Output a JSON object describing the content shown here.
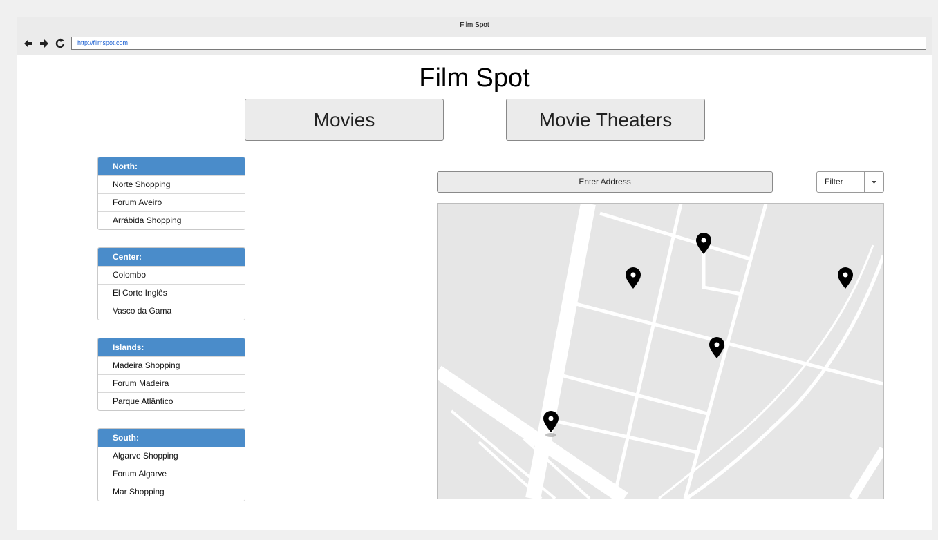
{
  "window": {
    "title": "Film Spot",
    "url": "http://filmspot.com"
  },
  "page": {
    "title": "Film Spot"
  },
  "nav": {
    "movies_label": "Movies",
    "theaters_label": "Movie Theaters"
  },
  "regions": [
    {
      "name": "North:",
      "items": [
        "Norte Shopping",
        "Forum Aveiro",
        "Arrábida Shopping"
      ]
    },
    {
      "name": "Center:",
      "items": [
        "Colombo",
        "El Corte Inglês",
        "Vasco da Gama"
      ]
    },
    {
      "name": "Islands:",
      "items": [
        "Madeira Shopping",
        "Forum Madeira",
        "Parque Atlântico"
      ]
    },
    {
      "name": "South:",
      "items": [
        "Algarve Shopping",
        "Forum Algarve",
        "Mar Shopping"
      ]
    }
  ],
  "search": {
    "address_label": "Enter Address",
    "filter_value": "Filter"
  },
  "icons": {
    "back": "back-arrow-icon",
    "forward": "forward-arrow-icon",
    "reload": "reload-icon",
    "pin": "map-pin-icon",
    "dropdown": "chevron-down-icon"
  },
  "colors": {
    "region_header": "#4a8cca",
    "map_background": "#e6e6e6",
    "road": "#ffffff",
    "pin": "#000000"
  }
}
